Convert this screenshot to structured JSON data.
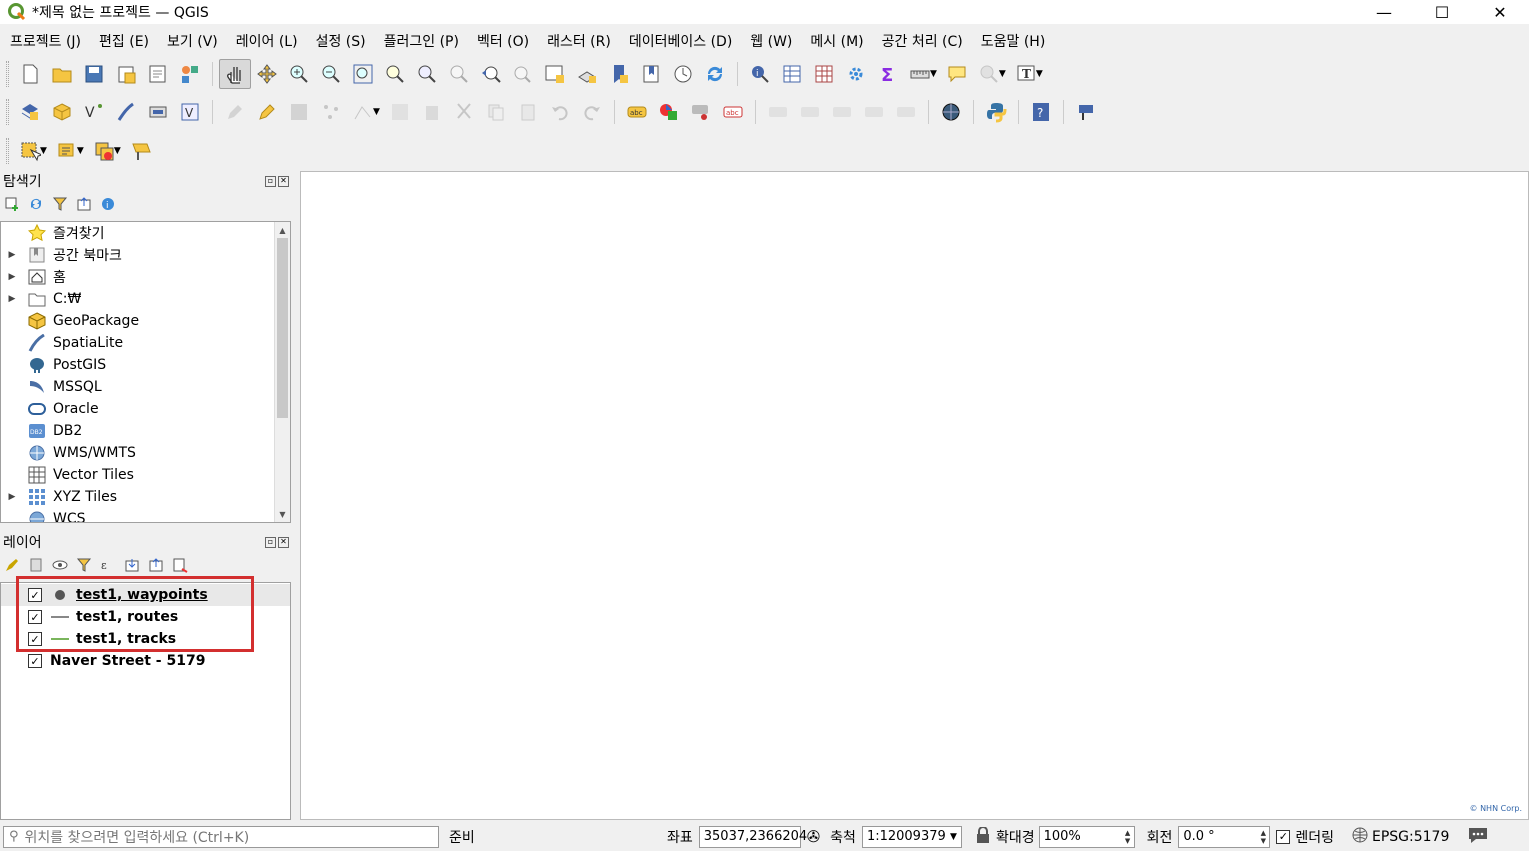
{
  "window": {
    "title": "*제목 없는 프로젝트 — QGIS",
    "minimize": "—",
    "maximize": "☐",
    "close": "✕"
  },
  "menu": [
    "프로젝트 (J)",
    "편집 (E)",
    "보기 (V)",
    "레이어 (L)",
    "설정 (S)",
    "플러그인 (P)",
    "벡터 (O)",
    "래스터 (R)",
    "데이터베이스 (D)",
    "웹 (W)",
    "메시 (M)",
    "공간 처리 (C)",
    "도움말 (H)"
  ],
  "browser": {
    "title": "탐색기",
    "items": [
      {
        "label": "즐겨찾기",
        "icon": "star-icon",
        "expandable": false
      },
      {
        "label": "공간 북마크",
        "icon": "bookmark-icon",
        "expandable": true
      },
      {
        "label": "홈",
        "icon": "home-icon",
        "expandable": true
      },
      {
        "label": "C:₩",
        "icon": "folder-icon",
        "expandable": true
      },
      {
        "label": "GeoPackage",
        "icon": "geopackage-icon",
        "expandable": false
      },
      {
        "label": "SpatiaLite",
        "icon": "spatialite-icon",
        "expandable": false
      },
      {
        "label": "PostGIS",
        "icon": "postgis-icon",
        "expandable": false
      },
      {
        "label": "MSSQL",
        "icon": "mssql-icon",
        "expandable": false
      },
      {
        "label": "Oracle",
        "icon": "oracle-icon",
        "expandable": false
      },
      {
        "label": "DB2",
        "icon": "db2-icon",
        "expandable": false
      },
      {
        "label": "WMS/WMTS",
        "icon": "wms-icon",
        "expandable": false
      },
      {
        "label": "Vector Tiles",
        "icon": "vector-tiles-icon",
        "expandable": false
      },
      {
        "label": "XYZ Tiles",
        "icon": "xyz-tiles-icon",
        "expandable": true
      },
      {
        "label": "WCS",
        "icon": "wcs-icon",
        "expandable": false
      }
    ]
  },
  "layers": {
    "title": "레이어",
    "items": [
      {
        "label": "test1, waypoints",
        "checked": "✓",
        "symbol": "point"
      },
      {
        "label": "test1, routes",
        "checked": "✓",
        "symbol": "line-gray"
      },
      {
        "label": "test1, tracks",
        "checked": "✓",
        "symbol": "line-green"
      },
      {
        "label": "Naver Street - 5179",
        "checked": "✓",
        "symbol": "none"
      }
    ]
  },
  "map": {
    "attribution": "© NHN Corp."
  },
  "status": {
    "search_placeholder": "위치를 찾으려면 입력하세요 (Ctrl+K)",
    "ready": "준비",
    "coord_label": "좌표",
    "coord_value": "35037,2366204",
    "scale_label": "축척",
    "scale_value": "1:12009379",
    "magnifier_label": "확대경",
    "magnifier_value": "100%",
    "rotation_label": "회전",
    "rotation_value": "0.0 °",
    "render_label": "렌더링",
    "render_checked": "✓",
    "crs": "EPSG:5179"
  },
  "colors": {
    "highlight": "#d32f2f",
    "qgis_green": "#589632"
  }
}
